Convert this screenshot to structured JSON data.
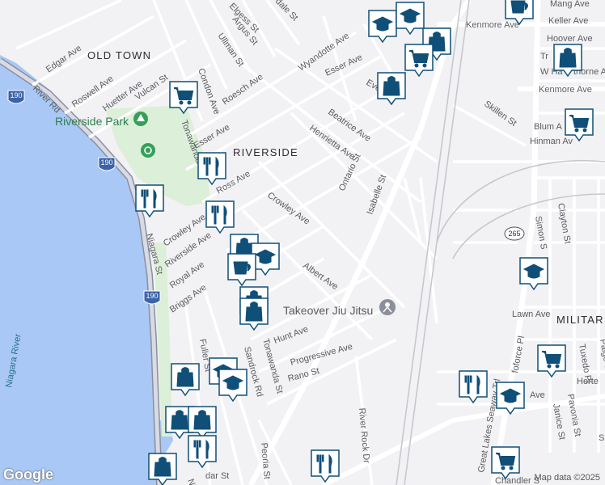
{
  "neighborhoods": {
    "old_town": "OLD TOWN",
    "riverside": "RIVERSIDE",
    "military": "MILITAR"
  },
  "water": {
    "river": "Niagara River"
  },
  "parks": {
    "riverside_park": "Riverside Park"
  },
  "place": {
    "takeover": "Takeover Jiu Jitsu"
  },
  "shields": {
    "i190_a": "190",
    "i190_b": "190",
    "i190_c": "190",
    "route265": "265"
  },
  "streets": {
    "elgess": "Elgess St",
    "dale": "dale St",
    "argus": "Argus St",
    "ullman": "Ullman St",
    "edgar": "Edgar Ave",
    "roswell": "Roswell Ave",
    "huetter": "Huetter Ave",
    "river_rd": "River Rd",
    "vulcan": "Vulcan St",
    "roesch": "Roesch Ave",
    "condon": "Condon Ave",
    "wyandotte": "Wyandotte Ave",
    "esser_ne": "Esser Ave",
    "esser_w": "Esser Ave",
    "eve": "Eve",
    "beatrice": "Beatrice Ave",
    "henrietta": "Henrietta Ave",
    "ontario": "Ontario St",
    "isabelle": "Isabelle St",
    "tonawanda_top": "Tonawanda St",
    "ross": "Ross Ave",
    "crowley_w": "Crowley Ave",
    "crowley": "Crowley Ave",
    "riverside_ave": "Riverside Ave",
    "royal": "Royal Ave",
    "briggs": "Briggs Ave",
    "niagara": "Niagara St",
    "albert": "Albert Ave",
    "hunt": "Hunt Ave",
    "progressive": "Progressive Ave",
    "rano": "Rano St",
    "sandrock": "Sandrock Rd",
    "tonawanda_bot": "Tonawanda St",
    "fuller": "Fuller St",
    "peoria": "Peoria St",
    "river_rock": "River Rock Dr",
    "great_lakes": "Great Lakes Seaway Trl",
    "kenmore_top": "Kenmore Ave",
    "kenmore_right": "Kenmore Ave",
    "mang": "Mang Ave",
    "keller": "Keller Ave",
    "hoover": "Hoover Ave",
    "tr_ave": "Tr",
    "w_ha": "W Ha",
    "thorne": "thorne Ave",
    "skillen": "Skillen St",
    "blum": "Blum A",
    "hinman": "Hinman Av",
    "simon": "Simon S",
    "clayton": "Clayton St",
    "lawn": "Lawn Ave",
    "tuxedo": "Tuxedo Pl",
    "paige": "Paige St",
    "pavonia": "Pavonia St",
    "janice": "Janice St",
    "herte": "Herte",
    "dar": "dar St",
    "foforce": "foforce Pl",
    "ave_bottom": "Ave",
    "niag_bottom": "Niag",
    "chandler": "Chandler S",
    "s_frag": "S"
  },
  "markers": [
    {
      "name": "school-marker-1",
      "icon": "graduation-cap"
    },
    {
      "name": "school-marker-2",
      "icon": "graduation-cap"
    },
    {
      "name": "coffee-marker-1",
      "icon": "coffee-cup"
    },
    {
      "name": "shop-marker-1",
      "icon": "shopping-bag"
    },
    {
      "name": "cart-marker-1",
      "icon": "shopping-cart"
    },
    {
      "name": "shop-marker-2",
      "icon": "shopping-bag"
    },
    {
      "name": "shop-marker-3",
      "icon": "shopping-bag"
    },
    {
      "name": "cart-marker-2",
      "icon": "shopping-cart"
    },
    {
      "name": "cart-marker-3",
      "icon": "shopping-cart"
    },
    {
      "name": "restaurant-marker-1",
      "icon": "fork-knife"
    },
    {
      "name": "restaurant-marker-2",
      "icon": "fork-knife"
    },
    {
      "name": "restaurant-marker-3",
      "icon": "fork-knife"
    },
    {
      "name": "shop-marker-4",
      "icon": "shopping-bag"
    },
    {
      "name": "school-marker-3",
      "icon": "graduation-cap"
    },
    {
      "name": "coffee-marker-2",
      "icon": "coffee-cup"
    },
    {
      "name": "shop-marker-5",
      "icon": "shopping-bag"
    },
    {
      "name": "shop-marker-6",
      "icon": "shopping-bag"
    },
    {
      "name": "school-marker-4",
      "icon": "graduation-cap"
    },
    {
      "name": "school-marker-5",
      "icon": "graduation-cap"
    },
    {
      "name": "shop-marker-7",
      "icon": "shopping-bag"
    },
    {
      "name": "shop-marker-8",
      "icon": "shopping-bag"
    },
    {
      "name": "shop-marker-9",
      "icon": "shopping-bag"
    },
    {
      "name": "restaurant-marker-4",
      "icon": "fork-knife"
    },
    {
      "name": "shop-marker-10",
      "icon": "shopping-bag"
    },
    {
      "name": "restaurant-marker-5",
      "icon": "fork-knife"
    },
    {
      "name": "school-marker-6",
      "icon": "graduation-cap"
    },
    {
      "name": "cart-marker-4",
      "icon": "shopping-cart"
    },
    {
      "name": "restaurant-marker-6",
      "icon": "fork-knife"
    },
    {
      "name": "school-marker-7",
      "icon": "graduation-cap"
    },
    {
      "name": "cart-marker-5",
      "icon": "shopping-cart"
    }
  ],
  "footer": {
    "logo": "Google",
    "attribution": "Map data ©2025"
  },
  "colors": {
    "water": "#9cc0f9",
    "park": "#d9ecd2",
    "marker_stroke": "#0f4f78",
    "road_major": "#ffffff"
  }
}
